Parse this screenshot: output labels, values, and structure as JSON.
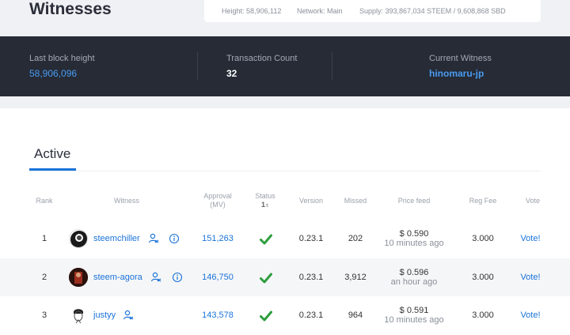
{
  "header": {
    "title": "Witnesses",
    "network": {
      "height": "Height: 58,906,112",
      "network": "Network: Main",
      "supply": "Supply: 393,867,034 STEEM / 9,608,868 SBD"
    }
  },
  "stats": {
    "block_label": "Last block height",
    "block_value": "58,906,096",
    "tx_label": "Transaction Count",
    "tx_value": "32",
    "witness_label": "Current Witness",
    "witness_value": "hinomaru-jp"
  },
  "tabs": {
    "active": "Active"
  },
  "table": {
    "headers": {
      "rank": "Rank",
      "witness": "Witness",
      "approval_1": "Approval",
      "approval_2": "(MV)",
      "status_1": "Status",
      "status_2": "1",
      "version": "Version",
      "missed": "Missed",
      "price": "Price feed",
      "regfee": "Reg Fee",
      "vote": "Vote"
    },
    "rows": [
      {
        "rank": "1",
        "name": "steemchiller",
        "approval": "151,263",
        "version": "0.23.1",
        "missed": "202",
        "price": "$ 0.590",
        "ago": "10 minutes ago",
        "regfee": "3.000",
        "vote": "Vote!"
      },
      {
        "rank": "2",
        "name": "steem-agora",
        "approval": "146,750",
        "version": "0.23.1",
        "missed": "3,912",
        "price": "$ 0.596",
        "ago": "an hour ago",
        "regfee": "3.000",
        "vote": "Vote!"
      },
      {
        "rank": "3",
        "name": "justyy",
        "approval": "143,578",
        "version": "0.23.1",
        "missed": "964",
        "price": "$ 0.591",
        "ago": "10 minutes ago",
        "regfee": "3.000",
        "vote": "Vote!"
      }
    ]
  },
  "colors": {
    "accent": "#1a73d9",
    "dark_bar": "#262b36",
    "status_ok": "#2e9e3e"
  }
}
